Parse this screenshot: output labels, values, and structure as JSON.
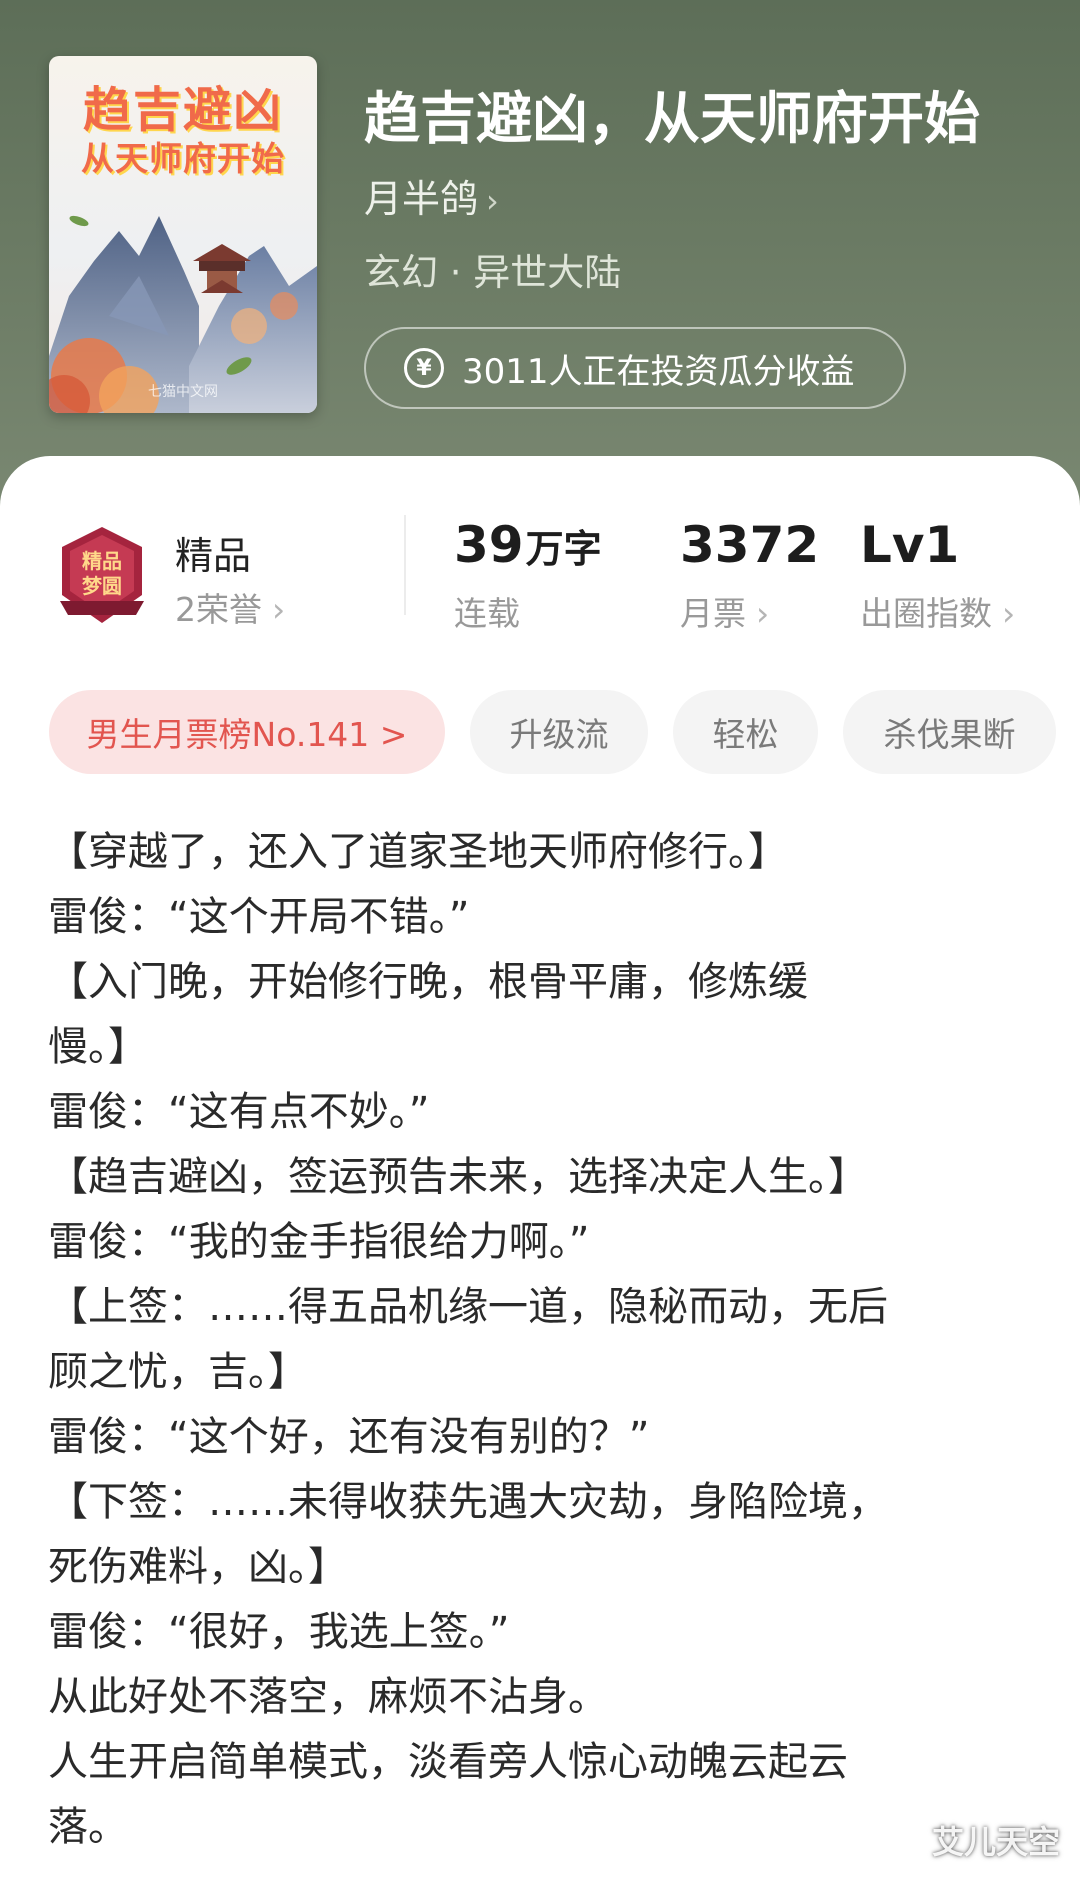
{
  "book": {
    "cover_title_line1": "趋吉避凶",
    "cover_title_line2": "从天师府开始",
    "cover_publisher": "七猫中文网",
    "title": "趋吉避凶，从天师府开始",
    "author": "月半鸽",
    "genre": "玄幻 · 异世大陆",
    "invest_text": "3011人正在投资瓜分收益",
    "invest_icon": "yen-circle-icon"
  },
  "honor": {
    "title": "精品",
    "sub": "2荣誉",
    "badge_text_1": "精品",
    "badge_text_2": "梦圆"
  },
  "stats": [
    {
      "value": "39",
      "unit": "万字",
      "label": "连载"
    },
    {
      "value": "3372",
      "unit": "",
      "label": "月票"
    },
    {
      "value": "Lv1",
      "unit": "",
      "label": "出圈指数"
    }
  ],
  "tags": [
    "男生月票榜No.141 >",
    "升级流",
    "轻松",
    "杀伐果断"
  ],
  "description": [
    "【穿越了，还入了道家圣地天师府修行。】",
    "雷俊：“这个开局不错。”",
    "【入门晚，开始修行晚，根骨平庸，修炼缓",
    "慢。】",
    "雷俊：“这有点不妙。”",
    "【趋吉避凶，签运预告未来，选择决定人生。】",
    "雷俊：“我的金手指很给力啊。”",
    "【上签：……得五品机缘一道，隐秘而动，无后",
    "顾之忧，吉。】",
    "雷俊：“这个好，还有没有别的？”",
    "【下签：……未得收获先遇大灾劫，身陷险境，",
    "死伤难料，凶。】",
    "雷俊：“很好，我选上签。”",
    "从此好处不落空，麻烦不沾身。",
    "人生开启简单模式，淡看旁人惊心动魄云起云",
    "落。"
  ],
  "watermark": "艾儿天空",
  "colors": {
    "header_bg": "#647460",
    "rank_tag_bg": "#fbe3e3",
    "rank_tag_text": "#e2554f",
    "cover_title": "#f06a4a"
  }
}
